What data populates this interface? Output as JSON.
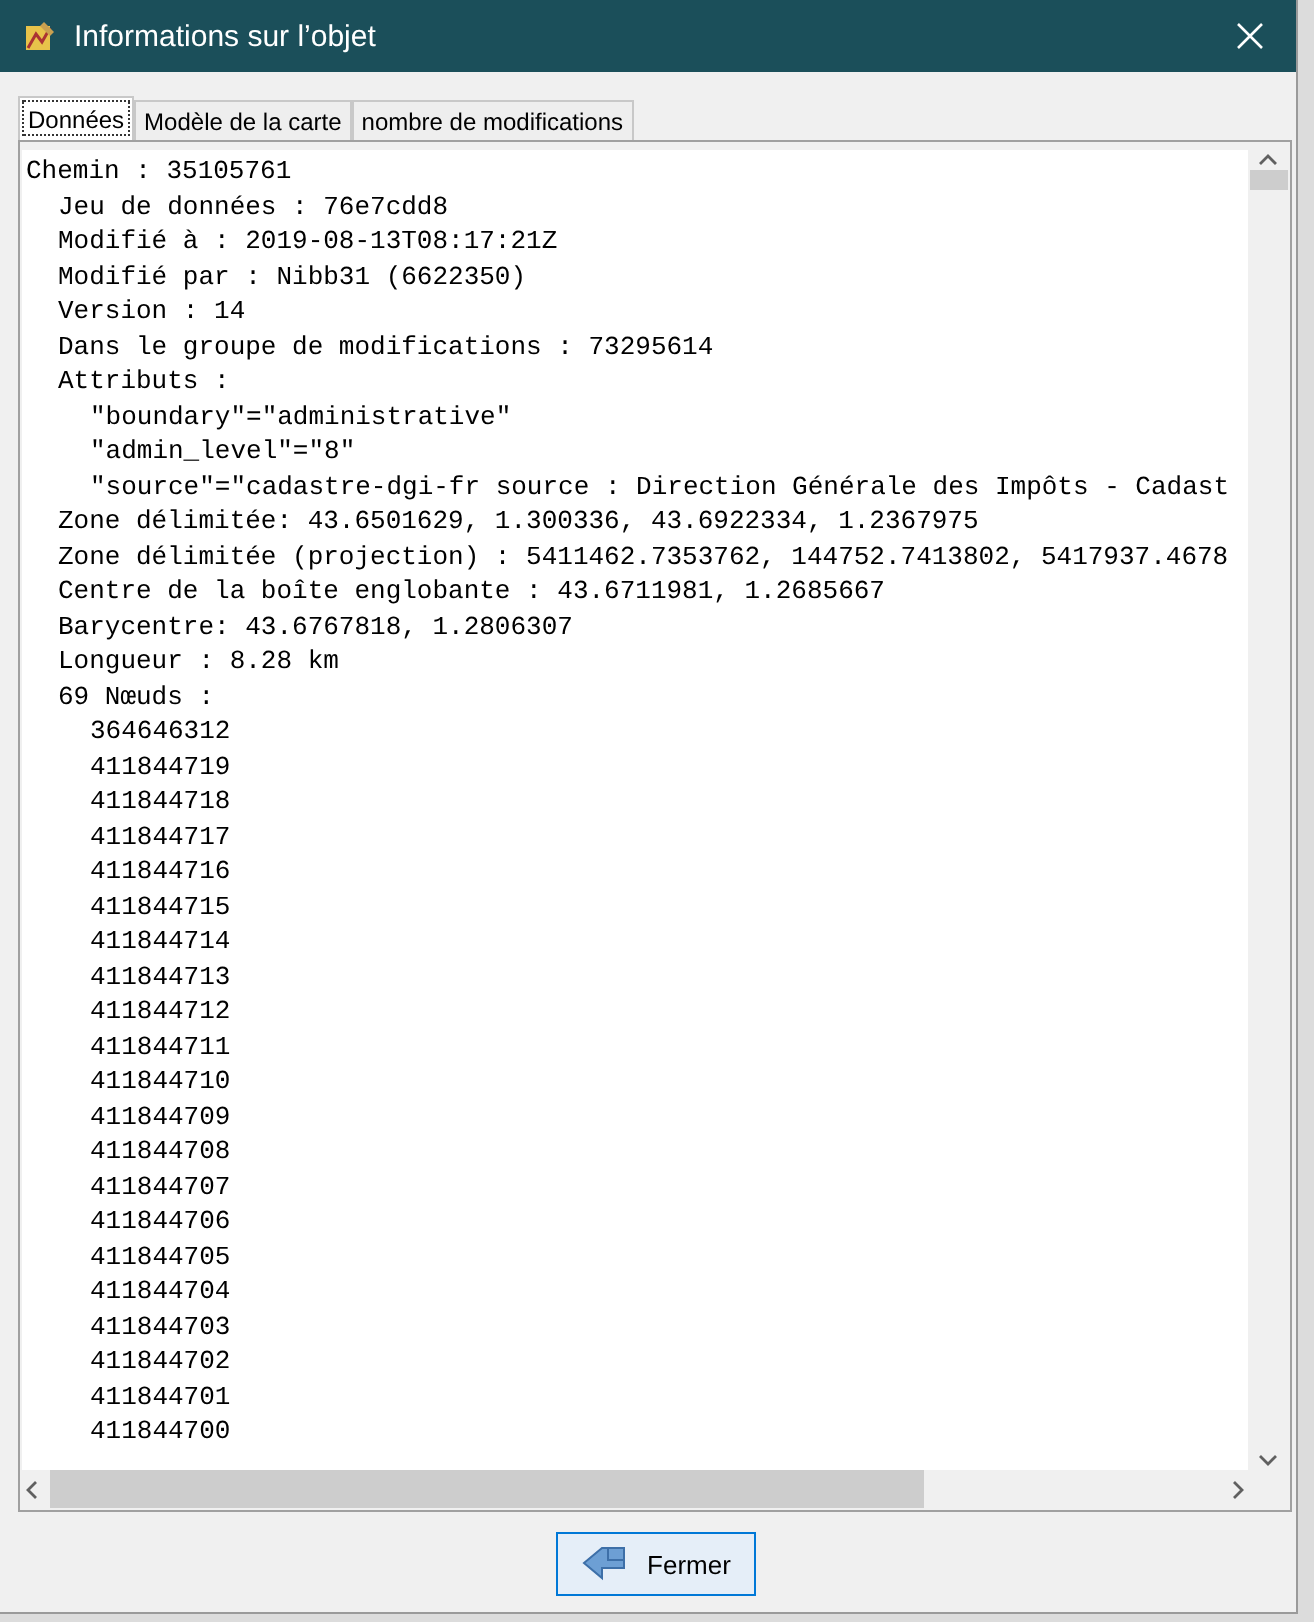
{
  "window": {
    "title": "Informations sur l’objet"
  },
  "tabs": [
    {
      "label": "Données",
      "selected": true
    },
    {
      "label": "Modèle de la carte",
      "selected": false
    },
    {
      "label": "nombre de modifications",
      "selected": false
    }
  ],
  "content": [
    {
      "text": "Chemin : 35105761",
      "children": [
        {
          "text": "Jeu de données : 76e7cdd8"
        },
        {
          "text": "Modifié à : 2019-08-13T08:17:21Z"
        },
        {
          "text": "Modifié par : Nibb31 (6622350)"
        },
        {
          "text": "Version : 14"
        },
        {
          "text": "Dans le groupe de modifications : 73295614"
        },
        {
          "text": "Attributs :",
          "children": [
            {
              "text": "\"boundary\"=\"administrative\""
            },
            {
              "text": "\"admin_level\"=\"8\""
            },
            {
              "text": "\"source\"=\"cadastre-dgi-fr source : Direction Générale des Impôts - Cadast"
            }
          ]
        },
        {
          "text": "Zone délimitée: 43.6501629, 1.300336, 43.6922334, 1.2367975"
        },
        {
          "text": "Zone délimitée (projection) : 5411462.7353762, 144752.7413802, 5417937.4678"
        },
        {
          "text": "Centre de la boîte englobante : 43.6711981, 1.2685667"
        },
        {
          "text": "Barycentre: 43.6767818, 1.2806307"
        },
        {
          "text": "Longueur : 8.28 km"
        },
        {
          "text": "69 Nœuds :",
          "children": [
            {
              "text": "364646312"
            },
            {
              "text": "411844719"
            },
            {
              "text": "411844718"
            },
            {
              "text": "411844717"
            },
            {
              "text": "411844716"
            },
            {
              "text": "411844715"
            },
            {
              "text": "411844714"
            },
            {
              "text": "411844713"
            },
            {
              "text": "411844712"
            },
            {
              "text": "411844711"
            },
            {
              "text": "411844710"
            },
            {
              "text": "411844709"
            },
            {
              "text": "411844708"
            },
            {
              "text": "411844707"
            },
            {
              "text": "411844706"
            },
            {
              "text": "411844705"
            },
            {
              "text": "411844704"
            },
            {
              "text": "411844703"
            },
            {
              "text": "411844702"
            },
            {
              "text": "411844701"
            },
            {
              "text": "411844700"
            }
          ]
        }
      ]
    }
  ],
  "close_button": {
    "label": "Fermer"
  }
}
